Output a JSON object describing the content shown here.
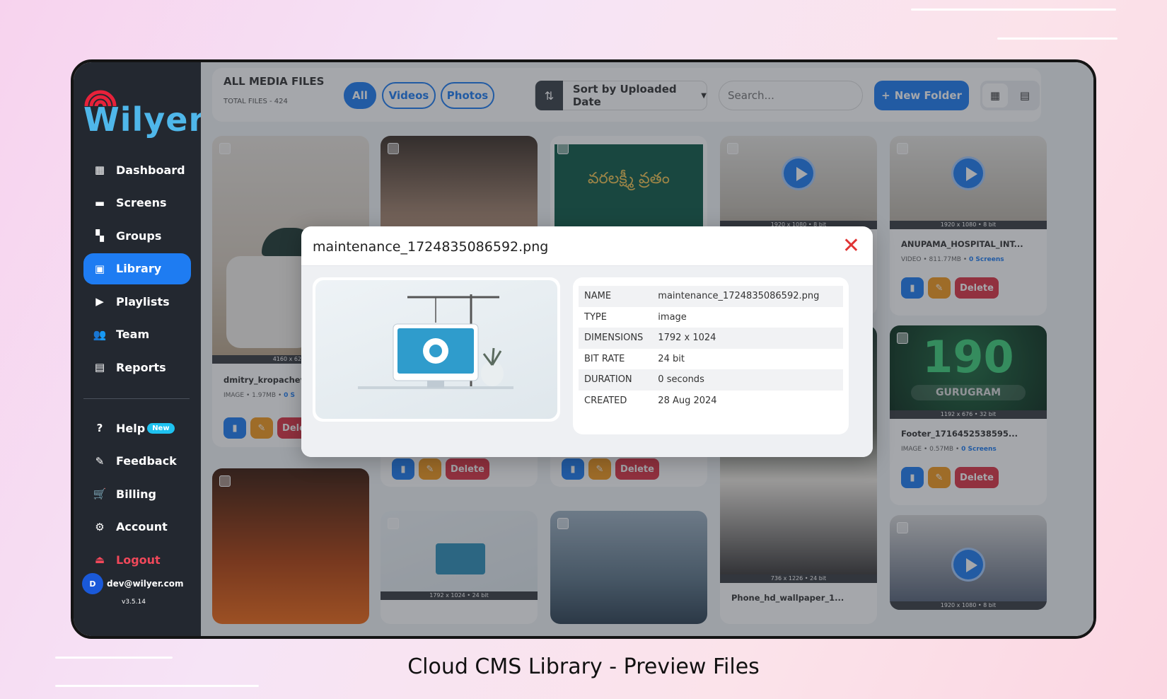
{
  "brand": {
    "logo": "Wilyer"
  },
  "sidebar": {
    "items": [
      {
        "label": "Dashboard",
        "icon": "dashboard-icon",
        "glyph": "▦"
      },
      {
        "label": "Screens",
        "icon": "monitor-icon",
        "glyph": "▬"
      },
      {
        "label": "Groups",
        "icon": "grid-icon",
        "glyph": "▚"
      },
      {
        "label": "Library",
        "icon": "film-icon",
        "glyph": "▣"
      },
      {
        "label": "Playlists",
        "icon": "folder-play-icon",
        "glyph": "▶"
      },
      {
        "label": "Team",
        "icon": "users-icon",
        "glyph": "👥"
      },
      {
        "label": "Reports",
        "icon": "report-icon",
        "glyph": "▤"
      }
    ],
    "bottom_items": [
      {
        "label": "Help",
        "icon": "help-icon",
        "glyph": "?"
      },
      {
        "label": "Feedback",
        "icon": "feedback-icon",
        "glyph": "✎"
      },
      {
        "label": "Billing",
        "icon": "cart-icon",
        "glyph": "🛒"
      },
      {
        "label": "Account",
        "icon": "gear-icon",
        "glyph": "⚙"
      },
      {
        "label": "Logout",
        "icon": "logout-icon",
        "glyph": "⏏"
      }
    ],
    "help_badge": "New",
    "user_initial": "D",
    "user_email": "dev@wilyer.com",
    "version": "v3.5.14"
  },
  "topbar": {
    "title": "ALL MEDIA FILES",
    "subtitle": "TOTAL FILES - 424",
    "filters": [
      "All",
      "Videos",
      "Photos"
    ],
    "sort_label": "Sort by Uploaded Date",
    "search_placeholder": "Search...",
    "new_folder_label": "New Folder"
  },
  "cards": [
    {
      "name": "dmitry_kropachev_",
      "type": "IMAGE",
      "size": "1.97MB",
      "screens": "0 S",
      "res": "4160 x 6240"
    },
    {
      "name": "",
      "type": "",
      "size": "",
      "screens": "",
      "res": ""
    },
    {
      "name": "",
      "type": "",
      "size": "",
      "screens": "",
      "res": ""
    },
    {
      "name": "",
      "type": "",
      "size": "",
      "screens": "",
      "res": "1920 x 1080 • 8 bit"
    },
    {
      "name": "ANUPAMA_HOSPITAL_INT...",
      "type": "VIDEO",
      "size": "811.77MB",
      "screens": "0 Screens",
      "res": "1920 x 1080 • 8 bit"
    },
    {
      "name": "Footer_1716452538595...",
      "type": "IMAGE",
      "size": "0.57MB",
      "screens": "0 Screens",
      "res": "1192 x 676 • 32 bit"
    },
    {
      "name": "Phone_hd_wallpaper_1...",
      "type": "",
      "size": "",
      "screens": "",
      "res": "736 x 1226 • 24 bit"
    },
    {
      "name": "",
      "type": "",
      "size": "",
      "screens": "",
      "res": "1792 x 1024 • 24 bit"
    },
    {
      "name": "",
      "type": "",
      "size": "",
      "screens": "",
      "res": "1920 x 1080 • 8 bit"
    }
  ],
  "card_texts": {
    "delete": "Delete",
    "gurugram_big": "190",
    "gurugram_small": "GURUGRAM",
    "telugu": "వరలక్ష్మీ వ్రతం"
  },
  "modal": {
    "title": "maintenance_1724835086592.png",
    "rows": [
      {
        "label": "NAME",
        "value": "maintenance_1724835086592.png"
      },
      {
        "label": "TYPE",
        "value": "image"
      },
      {
        "label": "DIMENSIONS",
        "value": "1792 x 1024"
      },
      {
        "label": "BIT RATE",
        "value": "24 bit"
      },
      {
        "label": "DURATION",
        "value": "0 seconds"
      },
      {
        "label": "CREATED",
        "value": "28 Aug 2024"
      }
    ]
  },
  "caption": "Cloud CMS Library - Preview Files",
  "colors": {
    "accent": "#1e7cf2",
    "danger": "#dc3545",
    "warning": "#f39a1e",
    "sidebar": "#232830"
  }
}
